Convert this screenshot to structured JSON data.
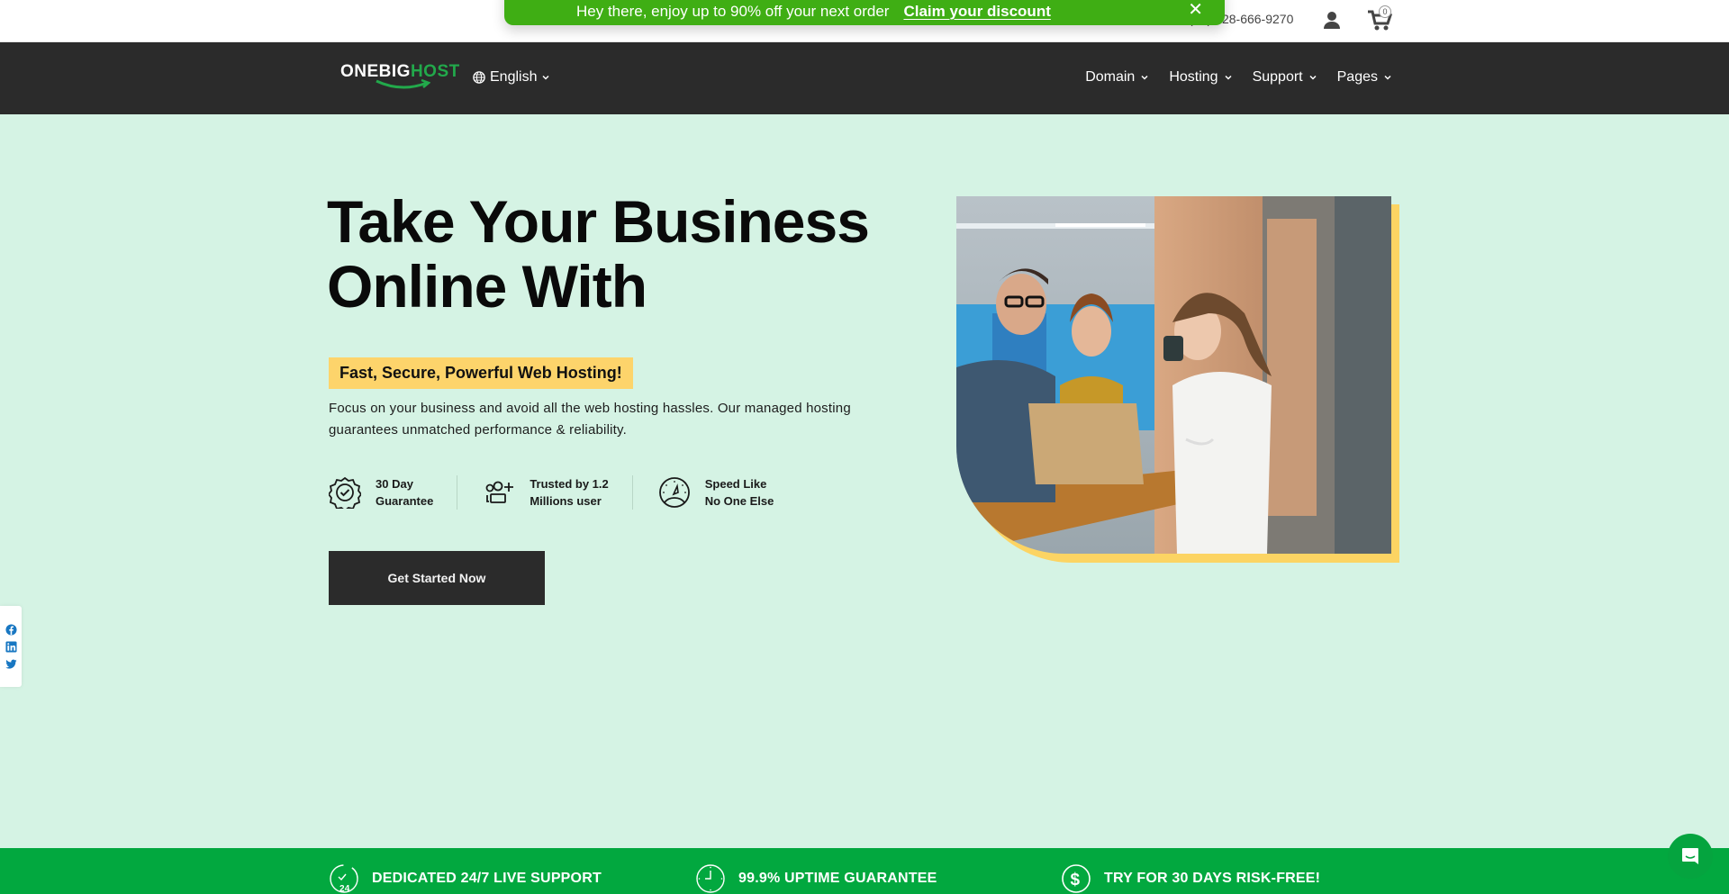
{
  "promo": {
    "text": "Hey there, enjoy up to 90% off your next order",
    "link_label": "Claim your discount",
    "close_label": "✕",
    "color": "#3fae14"
  },
  "topbar": {
    "phone": "(+1) 628-666-9270",
    "cart_count": "0"
  },
  "nav": {
    "logo_part1": "ONEBIG",
    "logo_part2": "HOST",
    "language": "English",
    "items": [
      {
        "label": "Domain"
      },
      {
        "label": "Hosting"
      },
      {
        "label": "Support"
      },
      {
        "label": "Pages"
      }
    ]
  },
  "hero": {
    "title_line1": "Take Your Business",
    "title_line2": "Online With",
    "tagline": "Fast, Secure, Powerful Web Hosting!",
    "description": "Focus on your business and avoid all the web hosting hassles. Our managed hosting guarantees unmatched performance & reliability.",
    "features": [
      {
        "icon": "badge-check-icon",
        "line1": "30 Day",
        "line2": "Guarantee"
      },
      {
        "icon": "add-users-icon",
        "line1": "Trusted by 1.2",
        "line2": "Millions user"
      },
      {
        "icon": "speedometer-icon",
        "line1": "Speed Like",
        "line2": "No One Else"
      }
    ],
    "cta_label": "Get Started Now",
    "image_alt": "Team working around a laptop in an office"
  },
  "social": [
    "facebook-icon",
    "linkedin-icon",
    "twitter-icon"
  ],
  "band": {
    "color": "#02a83f",
    "items": [
      {
        "icon": "support-24-icon",
        "label": "DEDICATED 24/7 LIVE SUPPORT"
      },
      {
        "icon": "clock-icon",
        "label": "99.9% UPTIME GUARANTEE"
      },
      {
        "icon": "dollar-icon",
        "label": "TRY FOR 30 DAYS RISK-FREE!"
      }
    ]
  },
  "colors": {
    "page_bg": "#d5f3e4",
    "nav_bg": "#2b2b2b",
    "accent_green": "#22a94b",
    "highlight_yellow": "#fdd46b"
  }
}
